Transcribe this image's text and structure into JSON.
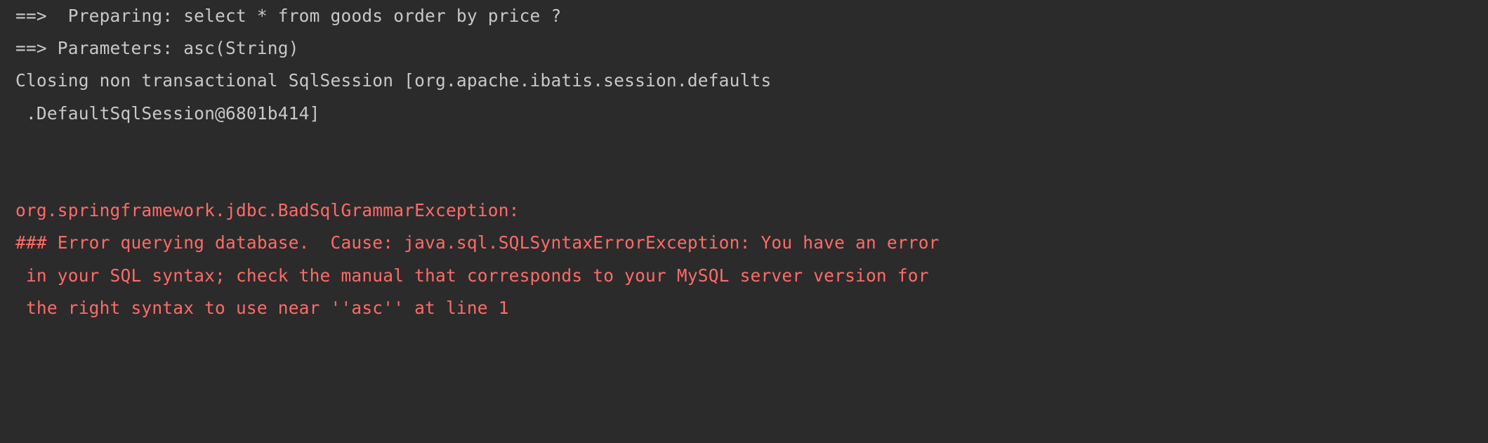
{
  "console": {
    "theme": {
      "background": "#2b2b2b",
      "info_color": "#c8c8c8",
      "error_color": "#ff6b68"
    },
    "lines": [
      {
        "id": "mybatis-preparing",
        "severity": "info",
        "text": "==>  Preparing: select * from goods order by price ?"
      },
      {
        "id": "mybatis-parameters",
        "severity": "info",
        "text": "==> Parameters: asc(String)"
      },
      {
        "id": "sqlsession-closing",
        "severity": "info",
        "text": "Closing non transactional SqlSession [org.apache.ibatis.session.defaults"
      },
      {
        "id": "sqlsession-closing-cont",
        "severity": "info",
        "text": " .DefaultSqlSession@6801b414]"
      },
      {
        "id": "blank-1",
        "severity": "info",
        "text": " "
      },
      {
        "id": "blank-2",
        "severity": "info",
        "text": " "
      },
      {
        "id": "exception-class",
        "severity": "error",
        "text": "org.springframework.jdbc.BadSqlGrammarException:"
      },
      {
        "id": "exception-message",
        "severity": "error",
        "text": "### Error querying database.  Cause: java.sql.SQLSyntaxErrorException: You have an error"
      },
      {
        "id": "exception-message-cont-1",
        "severity": "error",
        "text": " in your SQL syntax; check the manual that corresponds to your MySQL server version for"
      },
      {
        "id": "exception-message-cont-2",
        "severity": "error",
        "text": " the right syntax to use near ''asc'' at line 1"
      }
    ]
  }
}
